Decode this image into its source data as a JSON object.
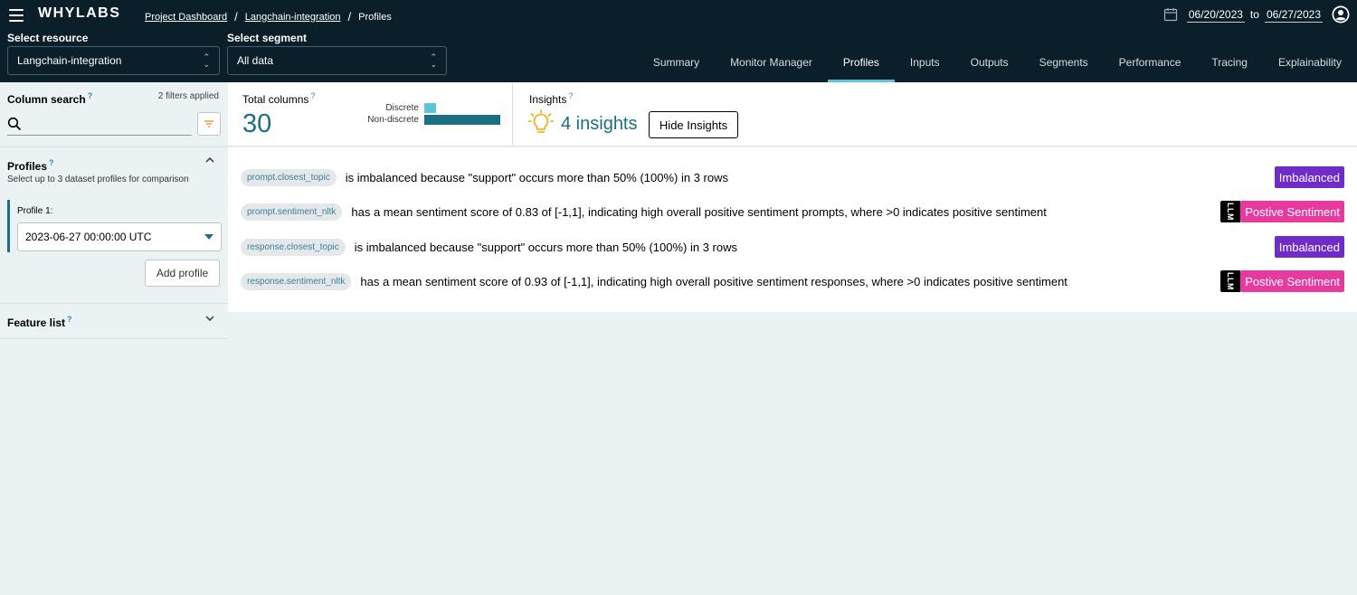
{
  "header": {
    "logo": "WHYLABS",
    "breadcrumb": [
      "Project Dashboard",
      "Langchain-integration",
      "Profiles"
    ],
    "date_from": "06/20/2023",
    "date_to_word": "to",
    "date_to": "06/27/2023",
    "resource_label": "Select resource",
    "resource_value": "Langchain-integration",
    "segment_label": "Select segment",
    "segment_value": "All data",
    "tabs": [
      {
        "label": "Summary",
        "active": false
      },
      {
        "label": "Monitor Manager",
        "active": false
      },
      {
        "label": "Profiles",
        "active": true
      },
      {
        "label": "Inputs",
        "active": false
      },
      {
        "label": "Outputs",
        "active": false
      },
      {
        "label": "Segments",
        "active": false
      },
      {
        "label": "Performance",
        "active": false
      },
      {
        "label": "Tracing",
        "active": false
      },
      {
        "label": "Explainability",
        "active": false
      }
    ]
  },
  "sidebar": {
    "column_search_title": "Column search",
    "help_mark": "?",
    "filters_applied": "2 filters applied",
    "search_placeholder": "",
    "profiles_title": "Profiles",
    "profiles_desc": "Select up to 3 dataset profiles for comparison",
    "profile_1_label": "Profile 1:",
    "profile_1_value": "2023-06-27 00:00:00 UTC",
    "add_profile_label": "Add profile",
    "feature_list_title": "Feature list"
  },
  "summary": {
    "total_columns_title": "Total columns",
    "total_columns_value": "30",
    "discrete_label": "Discrete",
    "non_discrete_label": "Non-discrete",
    "discrete_fraction": 0.15,
    "non_discrete_fraction": 1.0,
    "insights_title": "Insights",
    "insights_count": "4 insights",
    "hide_insights_label": "Hide Insights"
  },
  "insights": [
    {
      "column": "prompt.closest_topic",
      "text": "is imbalanced because \"support\" occurs more than 50% (100%) in 3 rows",
      "badge": "Imbalanced",
      "badge_type": "imbalanced",
      "llm": false
    },
    {
      "column": "prompt.sentiment_nltk",
      "text": "has a mean sentiment score of 0.83 of [-1,1], indicating high overall positive sentiment prompts, where >0 indicates positive sentiment",
      "badge": "Postive Sentiment",
      "badge_type": "sentiment",
      "llm": true
    },
    {
      "column": "response.closest_topic",
      "text": "is imbalanced because \"support\" occurs more than 50% (100%) in 3 rows",
      "badge": "Imbalanced",
      "badge_type": "imbalanced",
      "llm": false
    },
    {
      "column": "response.sentiment_nltk",
      "text": "has a mean sentiment score of 0.93 of [-1,1], indicating high overall positive sentiment responses, where >0 indicates positive sentiment",
      "badge": "Postive Sentiment",
      "badge_type": "sentiment",
      "llm": true
    }
  ],
  "llm_tag": "LLM",
  "colors": {
    "header_bg": "#0b1f2a",
    "accent": "#1c6e85",
    "discrete_bar": "#5bc4d6",
    "non_discrete_bar": "#1b6f83",
    "imbalanced": "#6f2cc9",
    "sentiment": "#e63aa0",
    "bulb": "#f2a900"
  },
  "icons": [
    "hamburger-icon",
    "calendar-icon",
    "user-avatar-icon",
    "updown-chevron-icon",
    "search-icon",
    "filter-icon",
    "chevron-up-icon",
    "chevron-down-icon",
    "caret-down-icon",
    "lightbulb-icon"
  ]
}
